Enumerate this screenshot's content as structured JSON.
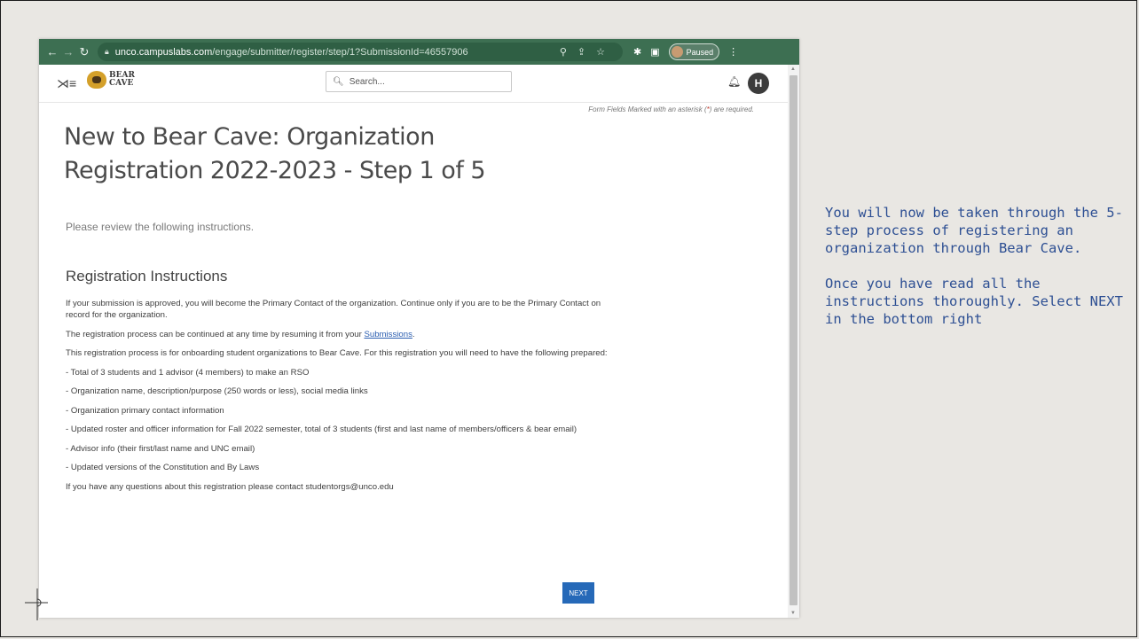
{
  "browser": {
    "url_domain": "unco.campuslabs.com",
    "url_path": "/engage/submitter/register/step/1?SubmissionId=46557906",
    "profile_label": "Paused"
  },
  "app": {
    "logo_line1": "BEAR",
    "logo_line2": "CAVE",
    "search_placeholder": "Search...",
    "avatar_initial": "H"
  },
  "form": {
    "required_note_pre": "Form Fields Marked with an asterisk (",
    "required_note_ast": "*",
    "required_note_post": ") are required.",
    "title": "New to Bear Cave: Organization Registration 2022-2023 - Step 1 of 5",
    "intro": "Please review the following instructions.",
    "section_heading": "Registration Instructions",
    "para_approved": "If your submission is approved, you will become the Primary Contact of the organization. Continue only if you are to be the Primary Contact on record for the organization.",
    "para_resume_pre": "The registration process can be continued at any time by resuming it from your ",
    "para_resume_link": "Submissions",
    "para_resume_post": ".",
    "para_onboarding": "This registration process is for onboarding student organizations to Bear Cave. For this registration you will need to have the following prepared:",
    "items": [
      "- Total of 3 students and 1 advisor (4 members) to make an RSO",
      "- Organization name, description/purpose (250 words or less), social media links",
      "- Organization primary contact information",
      "- Updated roster and officer information for Fall 2022 semester, total of 3 students (first and last name of members/officers & bear email)",
      "- Advisor info (their first/last name and UNC email)",
      "- Updated versions of the Constitution and By Laws"
    ],
    "para_questions": "If you have any questions about this registration please contact studentorgs@unco.edu",
    "next_label": "NEXT"
  },
  "side_note": {
    "para1": "You will now be taken through the 5-step process of registering an organization through Bear Cave.",
    "para2": "Once you have read all the instructions thoroughly. Select NEXT in the bottom right"
  },
  "colors": {
    "chrome": "#3d6f52",
    "next_button": "#2669b8",
    "side_note_text": "#2d4f93"
  }
}
